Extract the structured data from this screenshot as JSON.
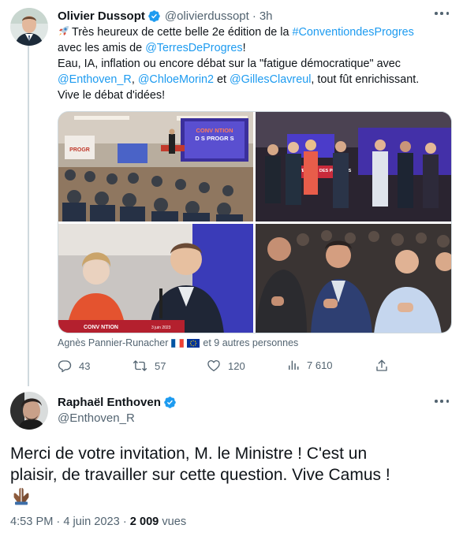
{
  "tweet1": {
    "author_name": "Olivier Dussopt",
    "handle": "@olivierdussopt",
    "separator": "·",
    "time": "3h",
    "text": {
      "l1_pre": "Très heureux de cette belle 2e édition de la ",
      "l1_tag": "#ConventiondesProgres",
      "l2_pre": "avec les amis de ",
      "l2_mention": "@TerresDeProgres",
      "l2_post": "!",
      "l3": "Eau, IA, inflation ou encore débat sur la \"fatigue démocratique\" avec",
      "l4_m1": "@Enthoven_R",
      "l4_sep1": ", ",
      "l4_m2": "@ChloeMorin2",
      "l4_sep2": " et ",
      "l4_m3": "@GillesClavreul",
      "l4_post": ", tout fût enrichissant.",
      "l5": "Vive le débat d'idées!"
    },
    "media": {
      "slide_title_1": "CONV NTION",
      "slide_title_2": "D S PROGR S",
      "podium_text": "CONVENTION DES PROGRÈS",
      "podium_text_2": "CONV  NTION",
      "podium_date": "3 juin 2023",
      "banner_left": "PROGR"
    },
    "tagged": {
      "person": "Agnès Pannier-Runacher",
      "others": "et 9 autres personnes"
    },
    "actions": {
      "replies": "43",
      "retweets": "57",
      "likes": "120",
      "views": "7 610"
    }
  },
  "tweet2": {
    "author_name": "Raphaël Enthoven",
    "handle": "@Enthoven_R",
    "text_l1": "Merci de votre invitation, M. le Ministre ! C'est un",
    "text_l2": "plaisir, de travailler sur cette question. Vive Camus !",
    "time": "4:53 PM",
    "separator": "·",
    "date": "4 juin 2023",
    "views_count": "2 009",
    "views_label": "vues"
  },
  "colors": {
    "accent": "#1d9bf0",
    "text": "#0f1419",
    "secondary": "#536471",
    "border": "#cfd9de"
  }
}
